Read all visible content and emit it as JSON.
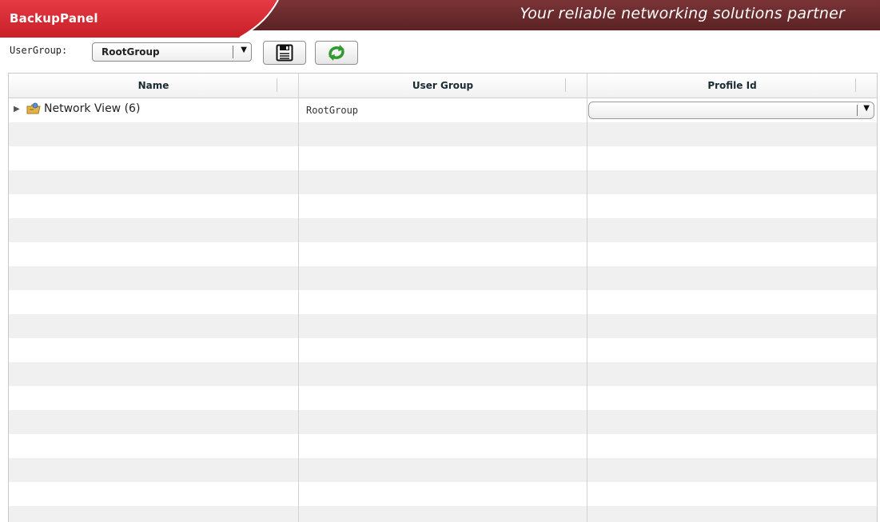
{
  "header": {
    "title": "BackupPanel",
    "tagline": "Your reliable networking solutions partner"
  },
  "toolbar": {
    "usergroup_label": "UserGroup:",
    "usergroup_selected": "RootGroup",
    "save_icon": "floppy-disk-icon",
    "refresh_icon": "refresh-icon"
  },
  "grid": {
    "columns": [
      "Name",
      "User Group",
      "Profile Id"
    ],
    "rows": [
      {
        "name": "Network View (6)",
        "user_group": "RootGroup",
        "profile_id": "",
        "expander_icon": "triangle-right-icon",
        "node_icon": "network-folder-icon"
      }
    ]
  },
  "colors": {
    "banner_red": "#d9232e",
    "banner_maroon": "#6b2a2c",
    "row_stripe": "#f0f0f0",
    "header_text": "#1a2b33"
  }
}
